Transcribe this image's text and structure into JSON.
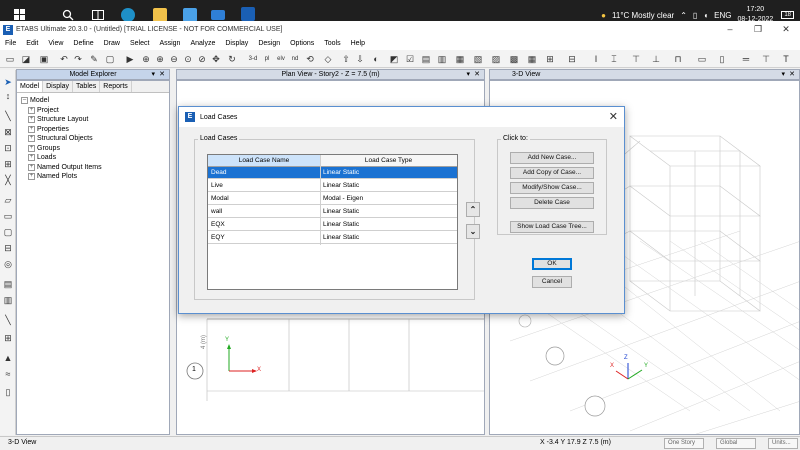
{
  "taskbar": {
    "weather": "11°C  Mostly clear",
    "language": "ENG",
    "time": "17:20",
    "date": "08-12-2022",
    "notifications": "18"
  },
  "window": {
    "title": "ETABS Ultimate 20.3.0 - (Untitled)  [TRIAL LICENSE - NOT FOR COMMERCIAL USE]",
    "logo": "E"
  },
  "menu": [
    "File",
    "Edit",
    "View",
    "Define",
    "Draw",
    "Select",
    "Assign",
    "Analyze",
    "Display",
    "Design",
    "Options",
    "Tools",
    "Help"
  ],
  "toolbar": {
    "view3d_label": "3-d",
    "plan_label": "pl",
    "elev_label": "elv",
    "nd_label": "nd"
  },
  "explorer": {
    "title": "Model Explorer",
    "tabs": [
      "Model",
      "Display",
      "Tables",
      "Reports"
    ],
    "root": "Model",
    "items": [
      "Project",
      "Structure Layout",
      "Properties",
      "Structural Objects",
      "Groups",
      "Loads",
      "Named Output Items",
      "Named Plots"
    ]
  },
  "planview": {
    "title": "Plan View - Story2 - Z = 7.5 (m)",
    "grid_bubble": "1",
    "dim_label": "4 (m)",
    "axis_x": "X",
    "axis_y": "Y"
  },
  "view3d": {
    "title": "3-D View",
    "axis_x": "X",
    "axis_y": "Y",
    "axis_z": "Z"
  },
  "status": {
    "left": "3-D View",
    "coords": "X -3.4  Y 17.9  Z 7.5 (m)",
    "story": "One Story",
    "coord_sys": "Global",
    "units": "Units..."
  },
  "dialog": {
    "title": "Load Cases",
    "group_label": "Load Cases",
    "col_name": "Load Case Name",
    "col_type": "Load Case Type",
    "rows": [
      {
        "name": "Dead",
        "type": "Linear Static"
      },
      {
        "name": "Live",
        "type": "Linear Static"
      },
      {
        "name": "Modal",
        "type": "Modal - Eigen"
      },
      {
        "name": "wall",
        "type": "Linear Static"
      },
      {
        "name": "EQX",
        "type": "Linear Static"
      },
      {
        "name": "EQY",
        "type": "Linear Static"
      }
    ],
    "click_to": "Click to:",
    "buttons": {
      "add_new": "Add New Case...",
      "add_copy": "Add Copy of Case...",
      "modify": "Modify/Show Case...",
      "delete": "Delete Case",
      "tree": "Show Load Case Tree...",
      "ok": "OK",
      "cancel": "Cancel"
    },
    "move_up": "«",
    "move_down": "»"
  },
  "colors": {
    "accent": "#1b72d2",
    "panel_header": "#d4dbe6",
    "taskbar": "#1f1f1f"
  }
}
